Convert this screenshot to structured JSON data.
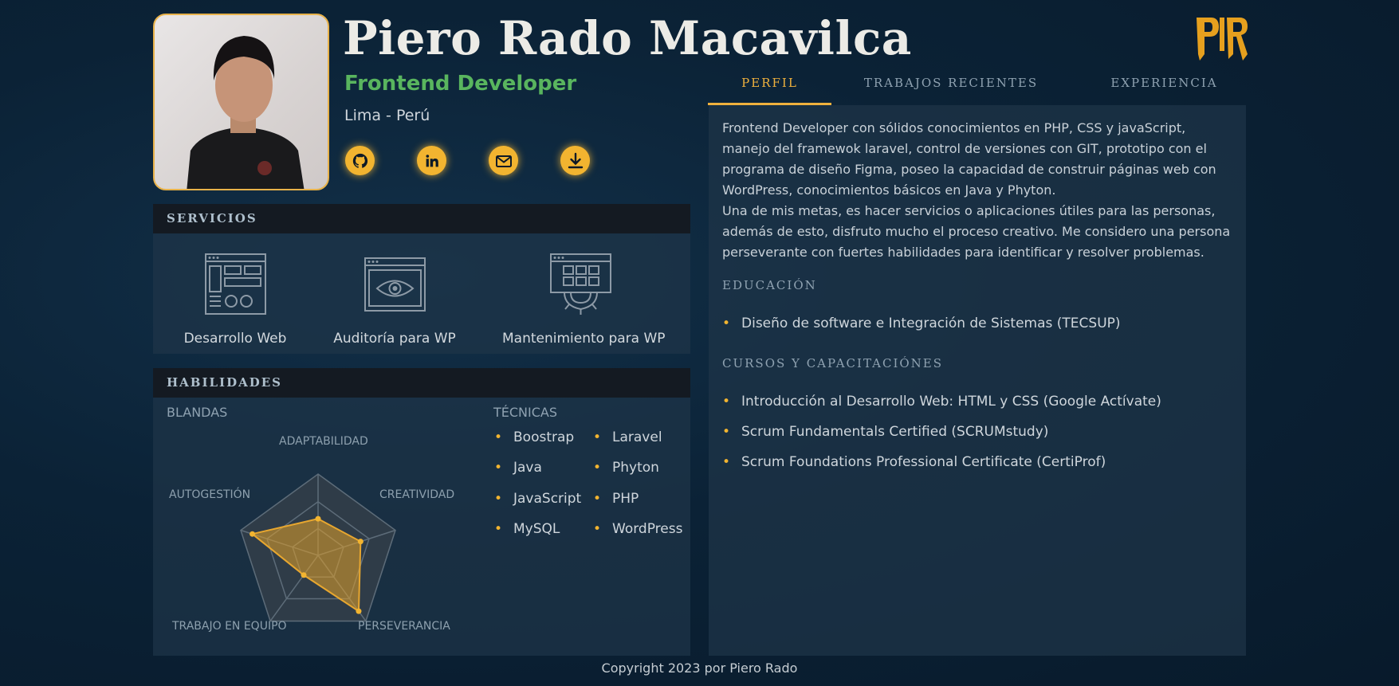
{
  "profile": {
    "name": "Piero Rado Macavilca",
    "role": "Frontend Developer",
    "location": "Lima - Perú",
    "logo": "PIR",
    "photo_alt": "profile-photo",
    "social": [
      {
        "icon": "github-icon"
      },
      {
        "icon": "linkedin-icon"
      },
      {
        "icon": "email-icon"
      },
      {
        "icon": "download-icon"
      }
    ]
  },
  "tabs": [
    "PERFIL",
    "TRABAJOS RECIENTES",
    "EXPERIENCIA"
  ],
  "services": {
    "title": "SERVICIOS",
    "items": [
      {
        "label": "Desarrollo Web",
        "icon": "web-layout-icon"
      },
      {
        "label": "Auditoría para WP",
        "icon": "eye-window-icon"
      },
      {
        "label": "Mantenimiento para WP",
        "icon": "gear-window-icon"
      }
    ]
  },
  "skills": {
    "title": "HABILIDADES",
    "soft_title": "BLANDAS",
    "tech_title": "TÉCNICAS",
    "radar_axes": [
      "ADAPTABILIDAD",
      "CREATIVIDAD",
      "PERSEVERANCIA",
      "TRABAJO EN EQUIPO",
      "AUTOGESTIÓN"
    ],
    "radar_values": [
      0.45,
      0.55,
      0.85,
      0.3,
      0.85
    ],
    "tech_col1": [
      "Boostrap",
      "Java",
      "JavaScript",
      "MySQL"
    ],
    "tech_col2": [
      "Laravel",
      "Phyton",
      "PHP",
      "WordPress"
    ]
  },
  "about": {
    "p1": "Frontend Developer con sólidos conocimientos en PHP, CSS y javaScript, manejo del framewok laravel, control de versiones con GIT, prototipo con el programa de diseño Figma, poseo la capacidad de construir páginas web con WordPress, conocimientos básicos en Java y Phyton.",
    "p2": "Una de mis metas, es hacer servicios o aplicaciones útiles para las personas, además de esto, disfruto mucho el proceso creativo. Me considero una persona perseverante con fuertes habilidades para identificar y resolver problemas.",
    "education_title": "EDUCACIÓN",
    "education": [
      "Diseño de software e Integración de Sistemas (TECSUP)"
    ],
    "courses_title": "CURSOS Y CAPACITACIÓNES",
    "courses": [
      "Introducción al Desarrollo Web: HTML y CSS (Google Actívate)",
      "Scrum Fundamentals Certified (SCRUMstudy)",
      "Scrum Foundations Professional Certificate (CertiProf)"
    ]
  },
  "footer": "Copyright 2023 por Piero Rado",
  "colors": {
    "accent": "#f2b430",
    "role_green": "#59b55e",
    "panel_head": "#141a22"
  }
}
